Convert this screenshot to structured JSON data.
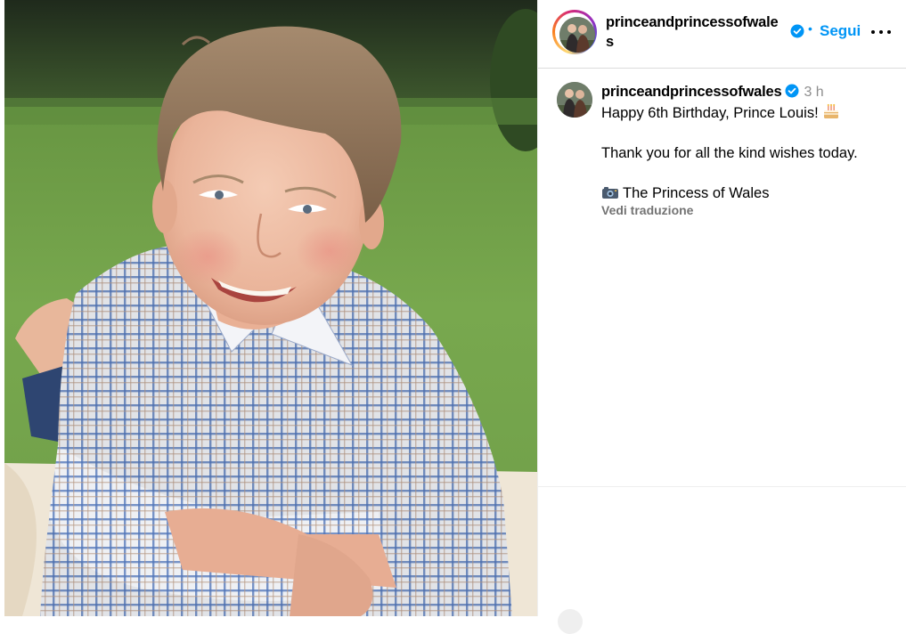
{
  "post": {
    "image_alt": "Photo of a smiling boy in a blue checked shirt lying on a blanket on the grass"
  },
  "header": {
    "username": "princeandprincessofwales",
    "separator": "•",
    "follow_label": "Segui",
    "more_icon": "more-horizontal-icon"
  },
  "caption": {
    "username": "princeandprincessofwales",
    "time": "3 h",
    "line1": "Happy 6th Birthday, Prince Louis!",
    "line2": "Thank you for all the kind wishes today.",
    "line3": "The Princess of Wales",
    "translate_label": "Vedi traduzione"
  },
  "colors": {
    "accent": "#0095f6",
    "muted_text": "#737373",
    "timestamp": "#8e8e8e",
    "divider": "#dbdbdb"
  }
}
